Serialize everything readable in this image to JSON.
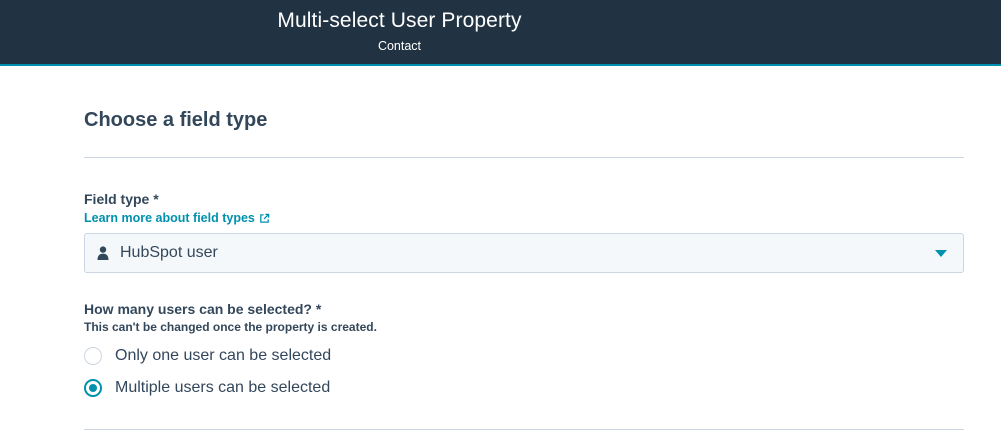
{
  "header": {
    "title": "Multi-select User Property",
    "subtitle": "Contact"
  },
  "section": {
    "title": "Choose a field type"
  },
  "field_type": {
    "label": "Field type *",
    "learn_more_link": "Learn more about field types",
    "selected_value": "HubSpot user",
    "selected_icon": "user-icon",
    "dropdown_icon": "caret-down-icon"
  },
  "selection_count": {
    "label": "How many users can be selected? *",
    "hint": "This can't be changed once the property is created.",
    "options": [
      {
        "label": "Only one user can be selected",
        "checked": false
      },
      {
        "label": "Multiple users can be selected",
        "checked": true
      }
    ]
  },
  "colors": {
    "header_bg": "#213343",
    "accent": "#0091ae",
    "text": "#33475b",
    "border": "#cbd6e2",
    "input_bg": "#f5f8fa"
  }
}
